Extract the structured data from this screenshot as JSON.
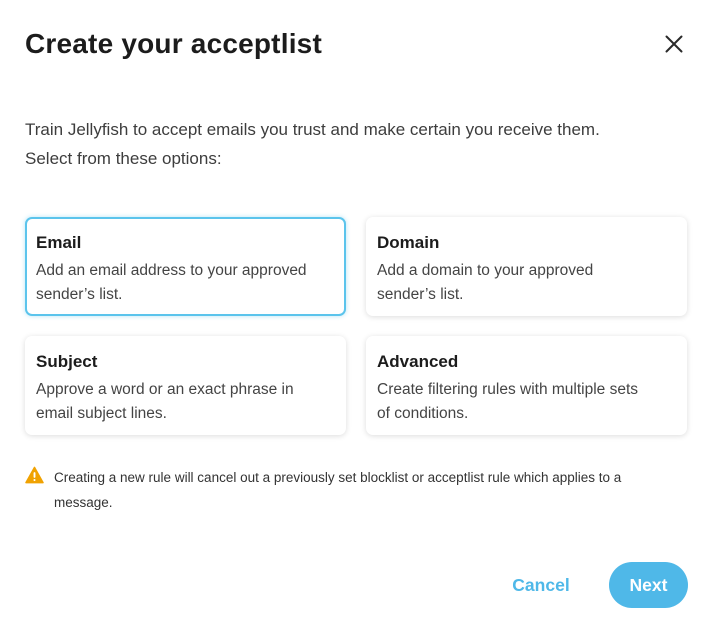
{
  "dialog": {
    "title": "Create your acceptlist",
    "close_icon": "close-icon",
    "intro_line1": "Train Jellyfish to accept emails you trust and make certain you receive them.",
    "intro_line2": "Select from these options:"
  },
  "options": [
    {
      "title": "Email",
      "desc_line1": "Add an email address to your approved",
      "desc_line2": "sender’s list.",
      "selected": true
    },
    {
      "title": "Domain",
      "desc_line1": "Add a domain to your approved",
      "desc_line2": "sender’s list.",
      "selected": false
    },
    {
      "title": "Subject",
      "desc_line1": "Approve a word or an exact phrase in",
      "desc_line2": "email subject lines.",
      "selected": false
    },
    {
      "title": "Advanced",
      "desc_line1": "Create filtering rules with multiple sets",
      "desc_line2": "of conditions.",
      "selected": false
    }
  ],
  "warning": {
    "icon": "warning-icon",
    "line1": "Creating a new rule will cancel out a previously set blocklist or acceptlist rule which applies to a",
    "line2": "message."
  },
  "footer": {
    "cancel_label": "Cancel",
    "next_label": "Next"
  },
  "colors": {
    "accent": "#4fb8e8",
    "selected_border": "#5bc4ec",
    "warning": "#f0a202"
  }
}
